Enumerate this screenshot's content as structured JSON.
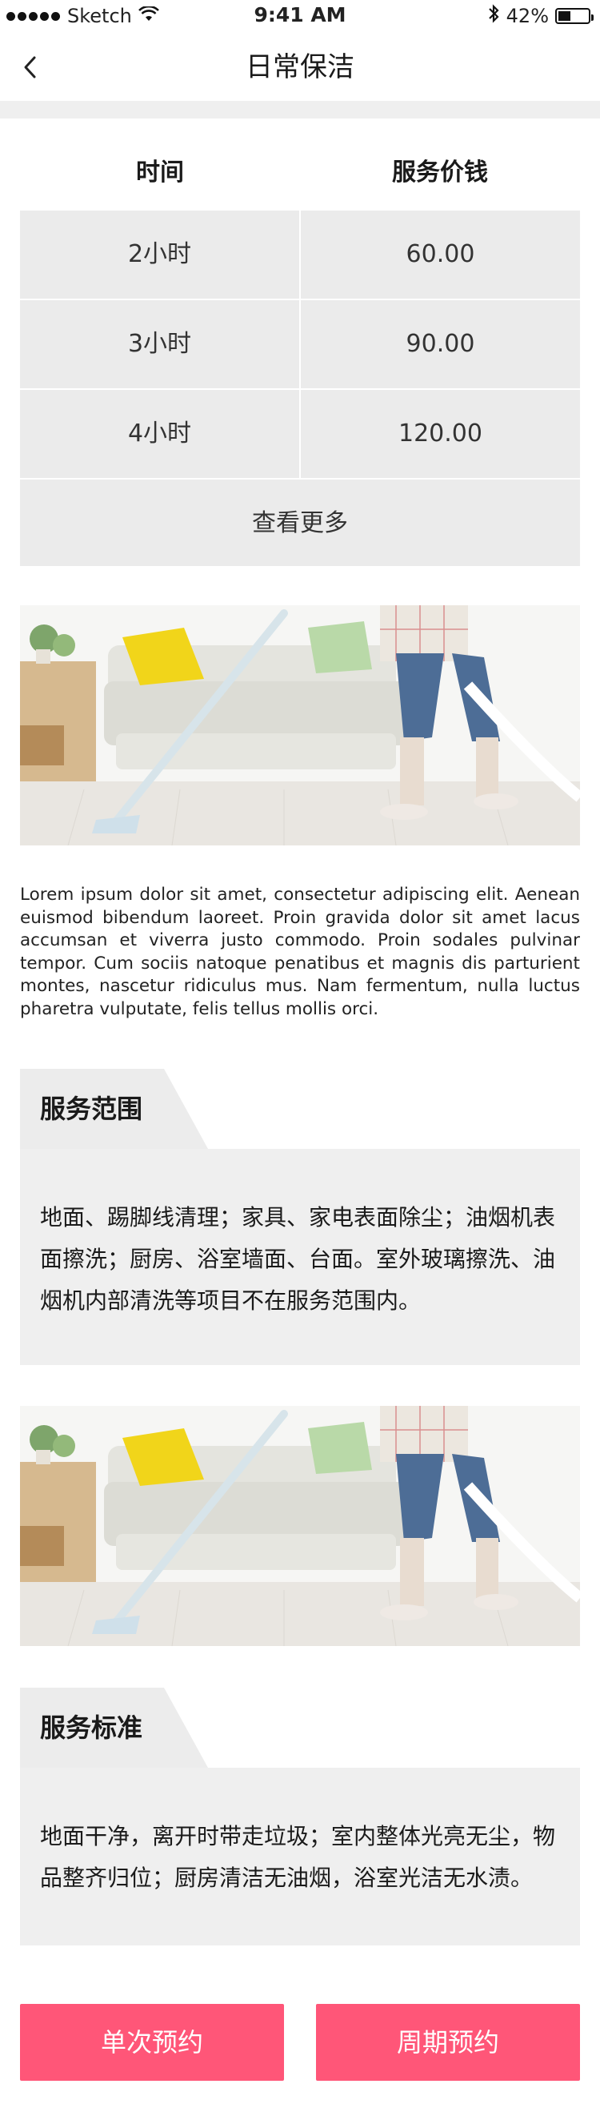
{
  "status_bar": {
    "carrier": "Sketch",
    "time": "9:41 AM",
    "battery": "42%",
    "battery_level": 0.42,
    "icons": [
      "signal-dots-icon",
      "wifi-icon",
      "bluetooth-icon",
      "battery-icon"
    ]
  },
  "nav": {
    "back_icon": "chevron-left-icon",
    "title": "日常保洁"
  },
  "price_table": {
    "headers": [
      "时间",
      "服务价钱"
    ],
    "rows": [
      {
        "time": "2小时",
        "price": "60.00"
      },
      {
        "time": "3小时",
        "price": "90.00"
      },
      {
        "time": "4小时",
        "price": "120.00"
      }
    ],
    "more_label": "查看更多"
  },
  "intro": {
    "text": "Lorem ipsum dolor sit amet, consectetur adipiscing elit. Aenean euismod bibendum laoreet. Proin gravida dolor sit amet lacus accumsan et viverra justo commodo. Proin sodales pulvinar tempor. Cum sociis natoque penatibus et magnis dis parturient montes, nascetur ridiculus mus. Nam fermentum, nulla luctus pharetra vulputate, felis tellus mollis orci."
  },
  "service_scope": {
    "title": "服务范围",
    "lines": [
      "地面、踢脚线清理；家具、家电表面除尘；油烟机表",
      "面擦洗；厨房、浴室墙面、台面。室外玻璃擦洗、油",
      "烟机内部清洗等项目不在服务范围内。"
    ]
  },
  "service_standard": {
    "title": "服务标准",
    "lines": [
      "地面干净，离开时带走垃圾；室内整体光亮无尘，物",
      "品整齐归位；厨房清洁无油烟，浴室光洁无水渍。"
    ]
  },
  "actions": {
    "single_booking": "单次预约",
    "periodic_booking": "周期预约"
  },
  "colors": {
    "accent": "#ff5678",
    "panel": "#ebebeb"
  }
}
